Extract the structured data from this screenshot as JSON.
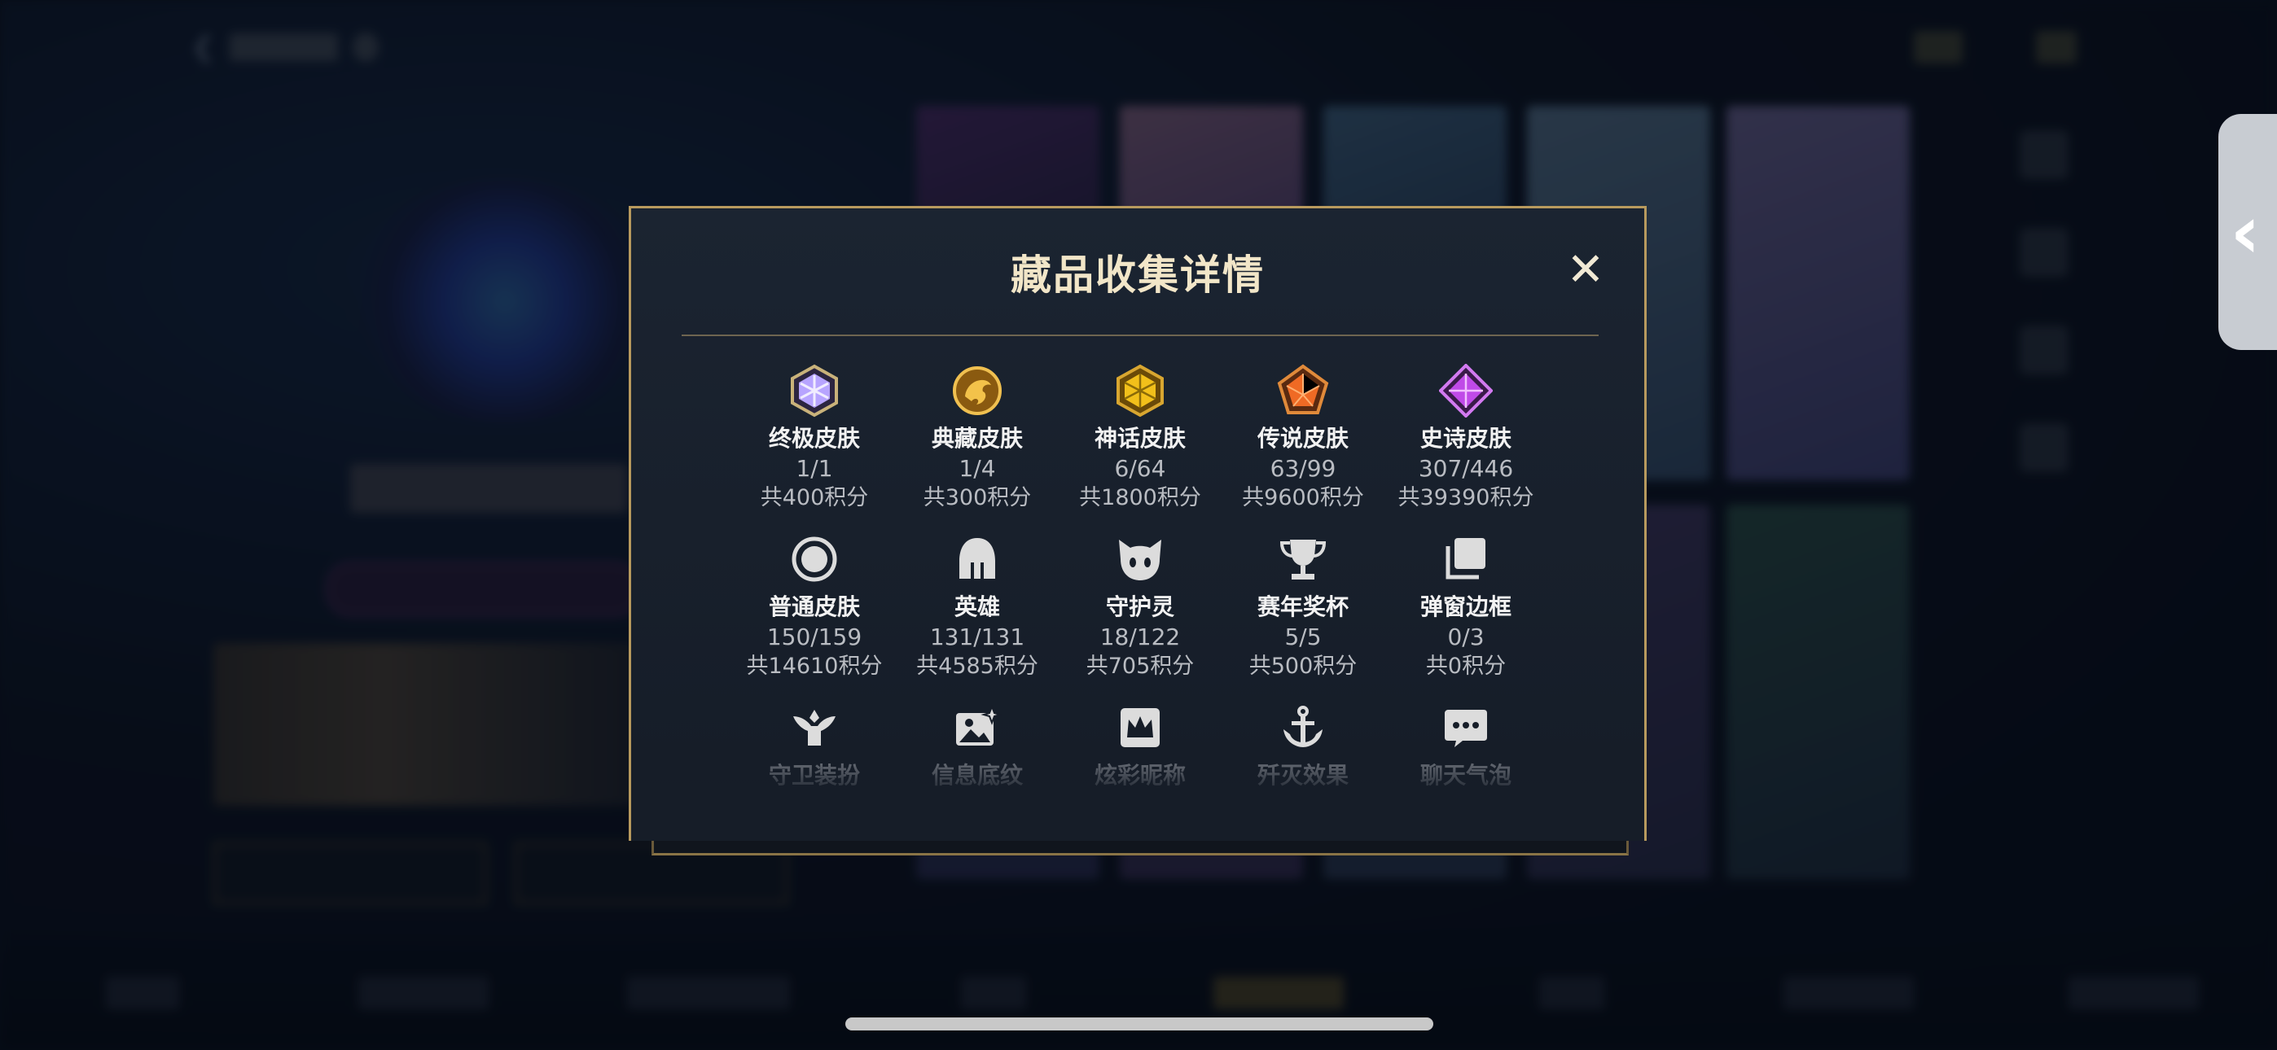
{
  "modal": {
    "title": "藏品收集详情",
    "close_label": "✕"
  },
  "categories": [
    {
      "label": "终极皮肤",
      "count": "1/1",
      "points": "共400积分",
      "icon": "ultimate-gem-icon"
    },
    {
      "label": "典藏皮肤",
      "count": "1/4",
      "points": "共300积分",
      "icon": "dragon-emblem-icon"
    },
    {
      "label": "神话皮肤",
      "count": "6/64",
      "points": "共1800积分",
      "icon": "mythic-gem-icon"
    },
    {
      "label": "传说皮肤",
      "count": "63/99",
      "points": "共9600积分",
      "icon": "legend-gem-icon"
    },
    {
      "label": "史诗皮肤",
      "count": "307/446",
      "points": "共39390积分",
      "icon": "epic-gem-icon"
    },
    {
      "label": "普通皮肤",
      "count": "150/159",
      "points": "共14610积分",
      "icon": "ring-icon"
    },
    {
      "label": "英雄",
      "count": "131/131",
      "points": "共4585积分",
      "icon": "helmet-icon"
    },
    {
      "label": "守护灵",
      "count": "18/122",
      "points": "共705积分",
      "icon": "spirit-pet-icon"
    },
    {
      "label": "赛年奖杯",
      "count": "5/5",
      "points": "共500积分",
      "icon": "trophy-icon"
    },
    {
      "label": "弹窗边框",
      "count": "0/3",
      "points": "共0积分",
      "icon": "cards-icon"
    },
    {
      "label": "守卫装扮",
      "icon": "guardian-figure-icon"
    },
    {
      "label": "信息底纹",
      "icon": "image-sparkle-icon"
    },
    {
      "label": "炫彩昵称",
      "icon": "crown-badge-icon"
    },
    {
      "label": "歼灭效果",
      "icon": "anchor-icon"
    },
    {
      "label": "聊天气泡",
      "icon": "chat-bubble-icon"
    }
  ],
  "colors": {
    "modal_border": "#b89a5e",
    "title": "#f2e6c8",
    "ultimate": "#b7a4ff",
    "dragon": "#e8a62a",
    "mythic": "#f2c01a",
    "legend": "#ef6a24",
    "epic": "#c04ae8"
  }
}
